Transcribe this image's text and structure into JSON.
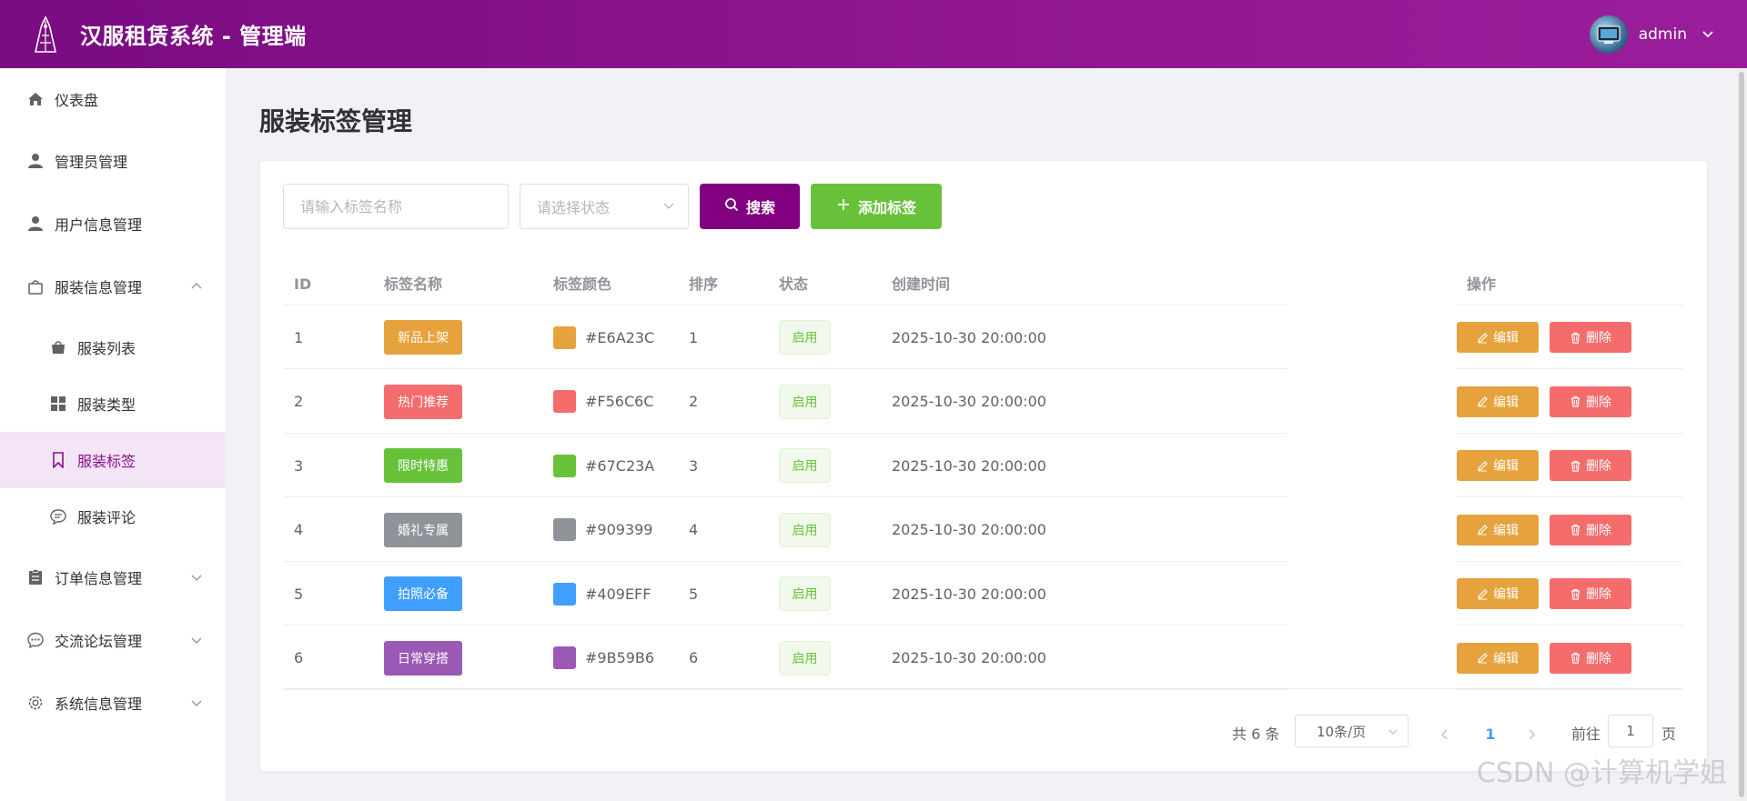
{
  "header": {
    "title": "汉服租赁系统 - 管理端",
    "username": "admin",
    "logo_icon": "hanfu-logo-icon",
    "brand_color": "#800080"
  },
  "sidebar": {
    "items": [
      {
        "label": "仪表盘",
        "icon": "home-icon"
      },
      {
        "label": "管理员管理",
        "icon": "user-icon"
      },
      {
        "label": "用户信息管理",
        "icon": "user-icon"
      },
      {
        "label": "服装信息管理",
        "icon": "shopping-bag-icon",
        "expanded": true
      },
      {
        "label": "订单信息管理",
        "icon": "clipboard-icon"
      },
      {
        "label": "交流论坛管理",
        "icon": "chat-dots-icon"
      },
      {
        "label": "系统信息管理",
        "icon": "gear-icon"
      }
    ],
    "subitems": [
      {
        "label": "服装列表",
        "icon": "bag-icon"
      },
      {
        "label": "服装类型",
        "icon": "grid-icon"
      },
      {
        "label": "服装标签",
        "icon": "bookmark-icon",
        "active": true
      },
      {
        "label": "服装评论",
        "icon": "comment-icon"
      }
    ],
    "active_color": "#8b0e8e"
  },
  "page": {
    "title": "服装标签管理"
  },
  "toolbar": {
    "name_placeholder": "请输入标签名称",
    "status_placeholder": "请选择状态",
    "search_label": "搜索",
    "add_label": "添加标签",
    "search_color": "#800080",
    "add_color": "#67c23a"
  },
  "table": {
    "columns": [
      "ID",
      "标签名称",
      "标签颜色",
      "排序",
      "状态",
      "创建时间",
      "操作"
    ],
    "rows": [
      {
        "id": "1",
        "name": "新品上架",
        "color": "#E6A23C",
        "sort": "1",
        "status": "启用",
        "created": "2025-10-30 20:00:00"
      },
      {
        "id": "2",
        "name": "热门推荐",
        "color": "#F56C6C",
        "sort": "2",
        "status": "启用",
        "created": "2025-10-30 20:00:00"
      },
      {
        "id": "3",
        "name": "限时特惠",
        "color": "#67C23A",
        "sort": "3",
        "status": "启用",
        "created": "2025-10-30 20:00:00"
      },
      {
        "id": "4",
        "name": "婚礼专属",
        "color": "#909399",
        "sort": "4",
        "status": "启用",
        "created": "2025-10-30 20:00:00"
      },
      {
        "id": "5",
        "name": "拍照必备",
        "color": "#409EFF",
        "sort": "5",
        "status": "启用",
        "created": "2025-10-30 20:00:00"
      },
      {
        "id": "6",
        "name": "日常穿搭",
        "color": "#9B59B6",
        "sort": "6",
        "status": "启用",
        "created": "2025-10-30 20:00:00"
      }
    ],
    "edit_label": "编辑",
    "delete_label": "删除"
  },
  "pagination": {
    "total": "共 6 条",
    "page_size": "10条/页",
    "current_page": "1",
    "goto_label": "前往",
    "goto_value": "1",
    "page_suffix": "页"
  },
  "watermark": "CSDN @计算机学姐"
}
